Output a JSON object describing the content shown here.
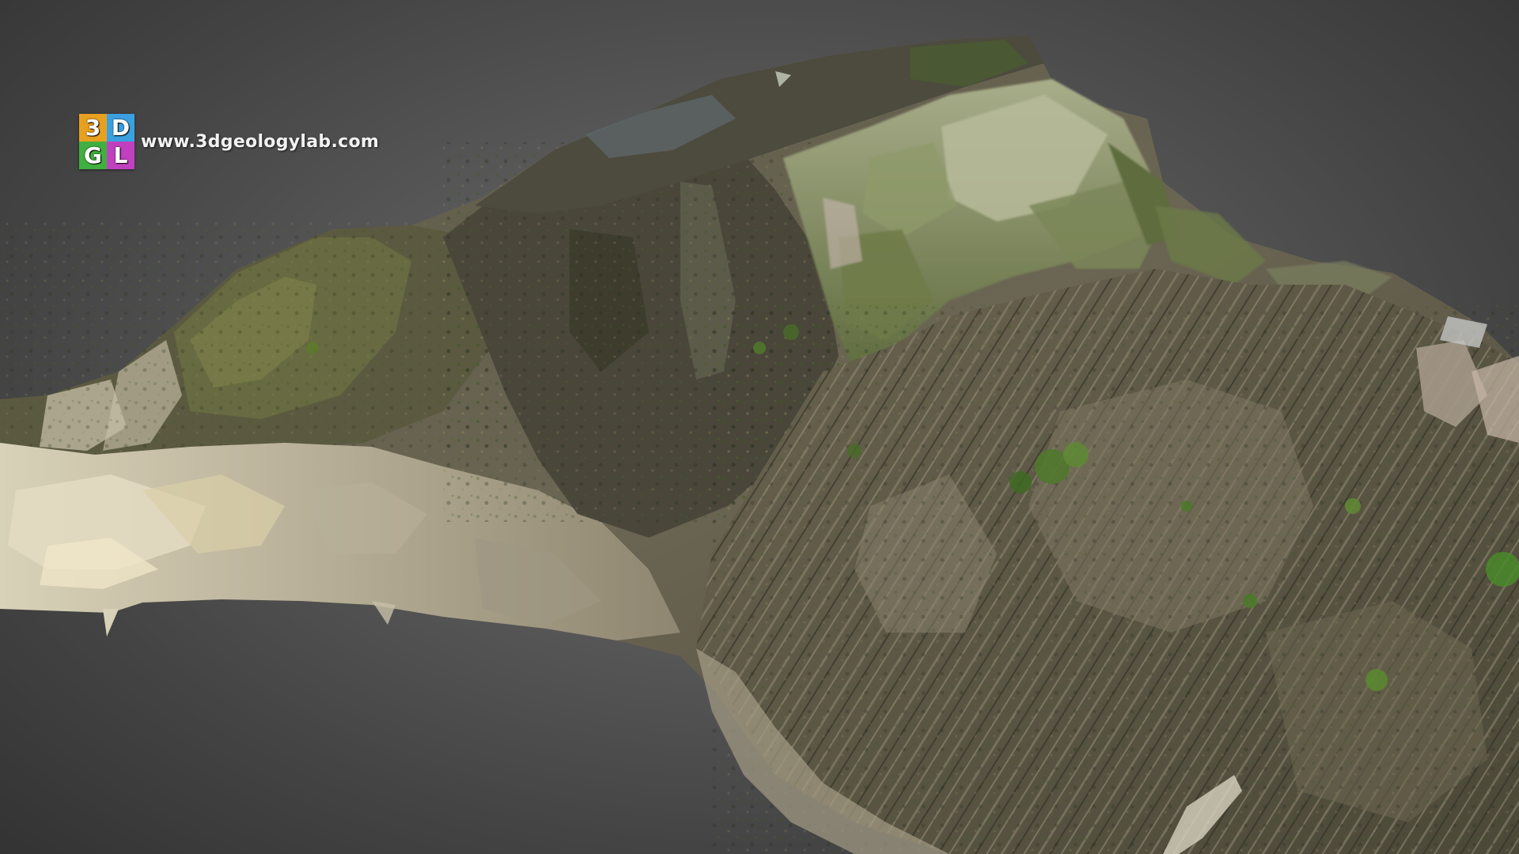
{
  "viewer": {
    "background_color": "#555555"
  },
  "watermark": {
    "logo_letters": [
      "3",
      "D",
      "G",
      "L"
    ],
    "logo_colors": [
      "#e8a020",
      "#3aa0e0",
      "#40b040",
      "#c040c0"
    ],
    "url_text": "www.3dgeologylab.com"
  },
  "model": {
    "colors": {
      "rock_dark": "#3d3a30",
      "rock_mid": "#6b6553",
      "rock_light": "#a39a86",
      "moss": "#5a6a38",
      "foliage": "#7f9060",
      "sand": "#c9bfa5",
      "water": "#d8d2b8"
    }
  }
}
